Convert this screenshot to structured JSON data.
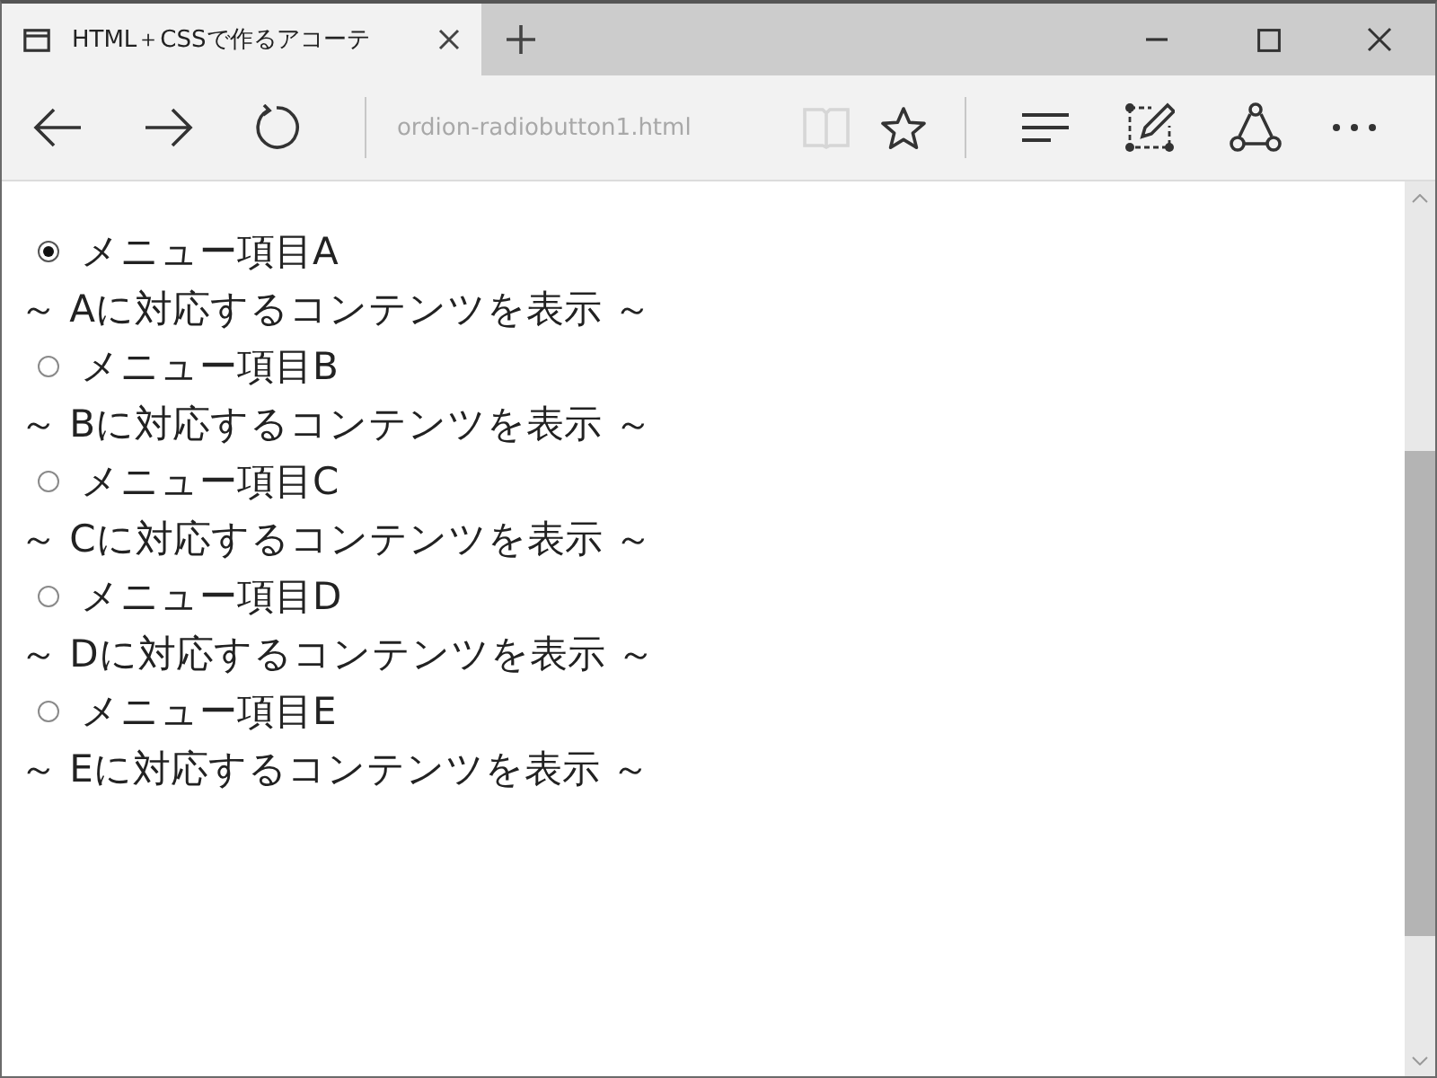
{
  "tabs": [
    {
      "title": "HTML＋CSSで作るアコーテ",
      "selected": true
    }
  ],
  "toolbar": {
    "nav": [
      {
        "kind": "back",
        "disabled": false
      },
      {
        "kind": "forward",
        "disabled": false
      },
      {
        "kind": "refresh",
        "disabled": false
      }
    ],
    "address": "ordion-radiobutton1.html",
    "address_actions": [
      {
        "kind": "reading-view",
        "disabled": true
      },
      {
        "kind": "favorite",
        "disabled": false
      }
    ],
    "tools": [
      {
        "kind": "hub"
      },
      {
        "kind": "web-note"
      },
      {
        "kind": "share"
      },
      {
        "kind": "more"
      }
    ]
  },
  "menu": {
    "items": [
      {
        "label": "メニュー項目A",
        "selected": true,
        "content": "～ Aに対応するコンテンツを表示 ～"
      },
      {
        "label": "メニュー項目B",
        "selected": false,
        "content": "～ Bに対応するコンテンツを表示 ～"
      },
      {
        "label": "メニュー項目C",
        "selected": false,
        "content": "～ Cに対応するコンテンツを表示 ～"
      },
      {
        "label": "メニュー項目D",
        "selected": false,
        "content": "～ Dに対応するコンテンツを表示 ～"
      },
      {
        "label": "メニュー項目E",
        "selected": false,
        "content": "～ Eに対応するコンテンツを表示 ～"
      }
    ]
  }
}
